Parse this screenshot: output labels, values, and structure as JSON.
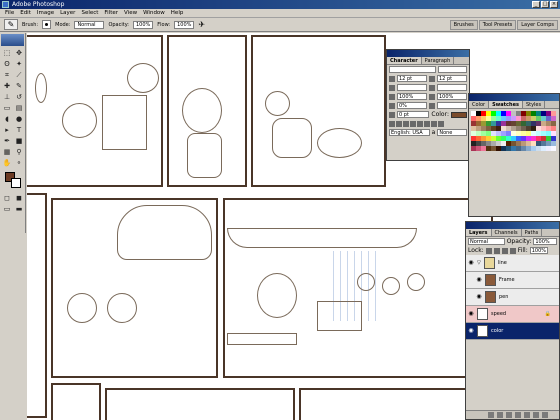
{
  "window": {
    "title": "Adobe Photoshop"
  },
  "menu": [
    "File",
    "Edit",
    "Image",
    "Layer",
    "Select",
    "Filter",
    "View",
    "Window",
    "Help"
  ],
  "options": {
    "brush_label": "Brush:",
    "mode_label": "Mode:",
    "mode_value": "Normal",
    "opacity_label": "Opacity:",
    "opacity_value": "100%",
    "flow_label": "Flow:",
    "flow_value": "100%"
  },
  "palette_well": [
    "Brushes",
    "Tool Presets",
    "Layer Comps"
  ],
  "character": {
    "tabs": [
      "Character",
      "Paragraph"
    ],
    "size": "12 pt",
    "leading": "12 pt",
    "scale_v": "100%",
    "scale_h": "100%",
    "tracking": "0%",
    "baseline": "0 pt",
    "color_label": "Color:",
    "language": "English: USA",
    "aa": "None"
  },
  "swatches": {
    "tabs": [
      "Color",
      "Swatches",
      "Styles"
    ],
    "colors": [
      "#ffffff",
      "#000000",
      "#ff0000",
      "#ffff00",
      "#00ff00",
      "#00ffff",
      "#0000ff",
      "#ff00ff",
      "#c0c0c0",
      "#808080",
      "#800000",
      "#808000",
      "#008000",
      "#008080",
      "#000080",
      "#800080",
      "#ff9999",
      "#ff6666",
      "#ff9966",
      "#ffcc66",
      "#ffff99",
      "#99ff99",
      "#66ffcc",
      "#66ccff",
      "#9999ff",
      "#cc99ff",
      "#ff99cc",
      "#cc6666",
      "#cc9966",
      "#cccc66",
      "#66cc66",
      "#66cccc",
      "#6666cc",
      "#cc66cc",
      "#993333",
      "#996633",
      "#999933",
      "#339933",
      "#339999",
      "#333399",
      "#993399",
      "#663333",
      "#664433",
      "#666633",
      "#336633",
      "#336666",
      "#333366",
      "#663366",
      "#ccaa88",
      "#aa8866",
      "#886644",
      "#e0c0a0",
      "#c0a080",
      "#a08060",
      "#806040",
      "#604020",
      "#402010",
      "#f0e0d0",
      "#d0c0b0",
      "#b0a090",
      "#908070",
      "#706050",
      "#504030",
      "#302010",
      "#ffe0e0",
      "#ffc0c0",
      "#ffa0a0",
      "#ff8080",
      "#e0ffe0",
      "#c0ffc0",
      "#a0ffa0",
      "#80ff80",
      "#e0e0ff",
      "#c0c0ff",
      "#a0a0ff",
      "#8080ff",
      "#ffffe0",
      "#ffffc0",
      "#ffffa0",
      "#ffff80",
      "#e0ffff",
      "#c0ffff",
      "#a0ffff",
      "#80ffff",
      "#ffe0ff",
      "#ff3333",
      "#ff6633",
      "#ff9933",
      "#ffcc33",
      "#ccff33",
      "#66ff33",
      "#33ff66",
      "#33ffcc",
      "#33ccff",
      "#3366ff",
      "#6633ff",
      "#cc33ff",
      "#ff33cc",
      "#ff3366",
      "#cc3333",
      "#33cc33",
      "#3333cc",
      "#222222",
      "#444444",
      "#666666",
      "#888888",
      "#aaaaaa",
      "#cccccc",
      "#eeeeee",
      "#552200",
      "#775533",
      "#997755",
      "#bb9977",
      "#ddbb99",
      "#ffddbb",
      "#335577",
      "#557799",
      "#7799bb",
      "#99bbdd",
      "#aa3355",
      "#cc5577",
      "#ee7799",
      "#553311",
      "#775533",
      "#331100",
      "#113355",
      "#225577",
      "#3377aa",
      "#446688",
      "#6688aa",
      "#88aacc",
      "#aaccee",
      "#ccddee",
      "#ddeeff",
      "#eeeeff",
      "#f8f8ff"
    ]
  },
  "layers": {
    "tabs": [
      "Layers",
      "Channels",
      "Paths"
    ],
    "blend": "Normal",
    "opacity_label": "Opacity:",
    "opacity_value": "100%",
    "lock_label": "Lock:",
    "fill_label": "Fill:",
    "fill_value": "100%",
    "items": [
      {
        "name": "line",
        "type": "folder"
      },
      {
        "name": "Frame",
        "type": "layer"
      },
      {
        "name": "pen",
        "type": "layer"
      },
      {
        "name": "speed",
        "type": "layer"
      },
      {
        "name": "color",
        "type": "layer",
        "selected": true
      }
    ]
  }
}
